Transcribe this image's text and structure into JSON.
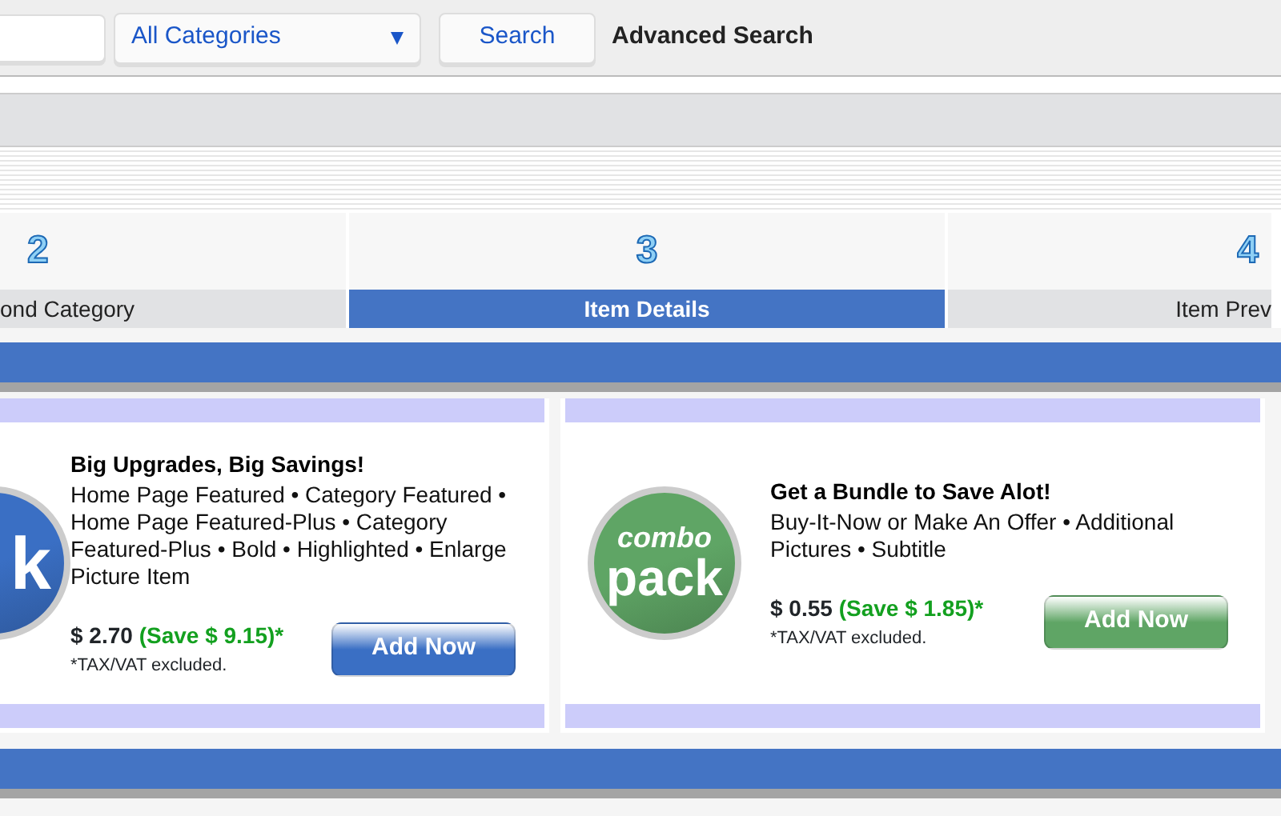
{
  "search_bar": {
    "category_select": "All Categories",
    "search_button": "Search",
    "advanced_link": "Advanced Search"
  },
  "steps": [
    {
      "number": "2",
      "label": "ond Category",
      "selected": false
    },
    {
      "number": "3",
      "label": "Item Details",
      "selected": true
    },
    {
      "number": "4",
      "label": "Item Prev",
      "selected": false
    }
  ],
  "packs": [
    {
      "logo_text": [
        "k"
      ],
      "color": "#3a6fc4",
      "title": "Big Upgrades, Big Savings!",
      "features": "Home Page Featured • Category Featured • Home Page Featured-Plus • Category Featured-Plus • Bold • Highlighted • Enlarge Picture Item",
      "price": "$ 2.70",
      "saving": "(Save $ 9.15)",
      "asterisk": "*",
      "tax_note": "*TAX/VAT excluded.",
      "button": "Add Now"
    },
    {
      "logo_text": [
        "combo",
        "pack"
      ],
      "color": "#5fa565",
      "title": "Get a Bundle to Save Alot!",
      "features": "Buy-It-Now or Make An Offer • Additional Pictures • Subtitle",
      "price": "$ 0.55",
      "saving": "(Save $ 1.85)",
      "asterisk": "*",
      "tax_note": "*TAX/VAT excluded.",
      "button": "Add Now"
    }
  ]
}
